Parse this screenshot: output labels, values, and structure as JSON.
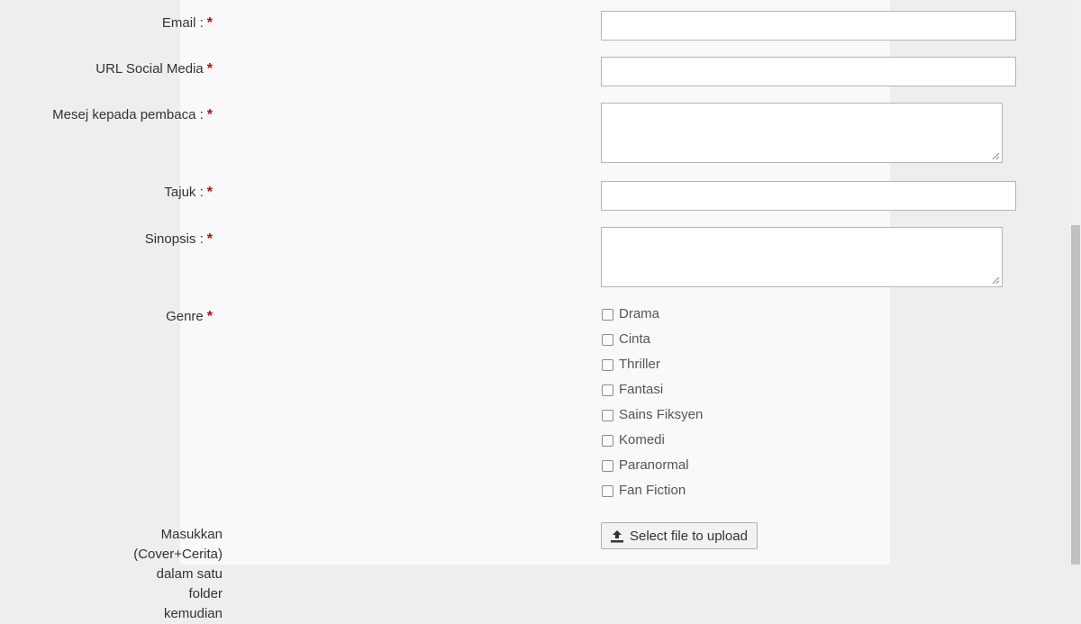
{
  "form": {
    "email": {
      "label": "Email :",
      "required_mark": "*",
      "value": ""
    },
    "url_social": {
      "label": "URL Social Media",
      "required_mark": "*",
      "value": ""
    },
    "mesej": {
      "label": "Mesej kepada pembaca :",
      "required_mark": "*",
      "value": ""
    },
    "tajuk": {
      "label": "Tajuk :",
      "required_mark": "*",
      "value": ""
    },
    "sinopsis": {
      "label": "Sinopsis :",
      "required_mark": "*",
      "value": ""
    },
    "genre": {
      "label": "Genre",
      "required_mark": "*",
      "options": [
        {
          "label": "Drama",
          "checked": false
        },
        {
          "label": "Cinta",
          "checked": false
        },
        {
          "label": "Thriller",
          "checked": false
        },
        {
          "label": "Fantasi",
          "checked": false
        },
        {
          "label": "Sains Fiksyen",
          "checked": false
        },
        {
          "label": "Komedi",
          "checked": false
        },
        {
          "label": "Paranormal",
          "checked": false
        },
        {
          "label": "Fan Fiction",
          "checked": false
        }
      ]
    },
    "upload": {
      "label_line1": "Masukkan (Cover+Cerita)",
      "label_line2": "dalam satu folder kemudian",
      "button_label": "Select file to upload",
      "icon": "upload-icon"
    }
  },
  "colors": {
    "required": "#cc0000",
    "panel_bg": "#f9f9fb",
    "page_bg": "#eeeeef",
    "input_border": "#b5b5b5"
  }
}
